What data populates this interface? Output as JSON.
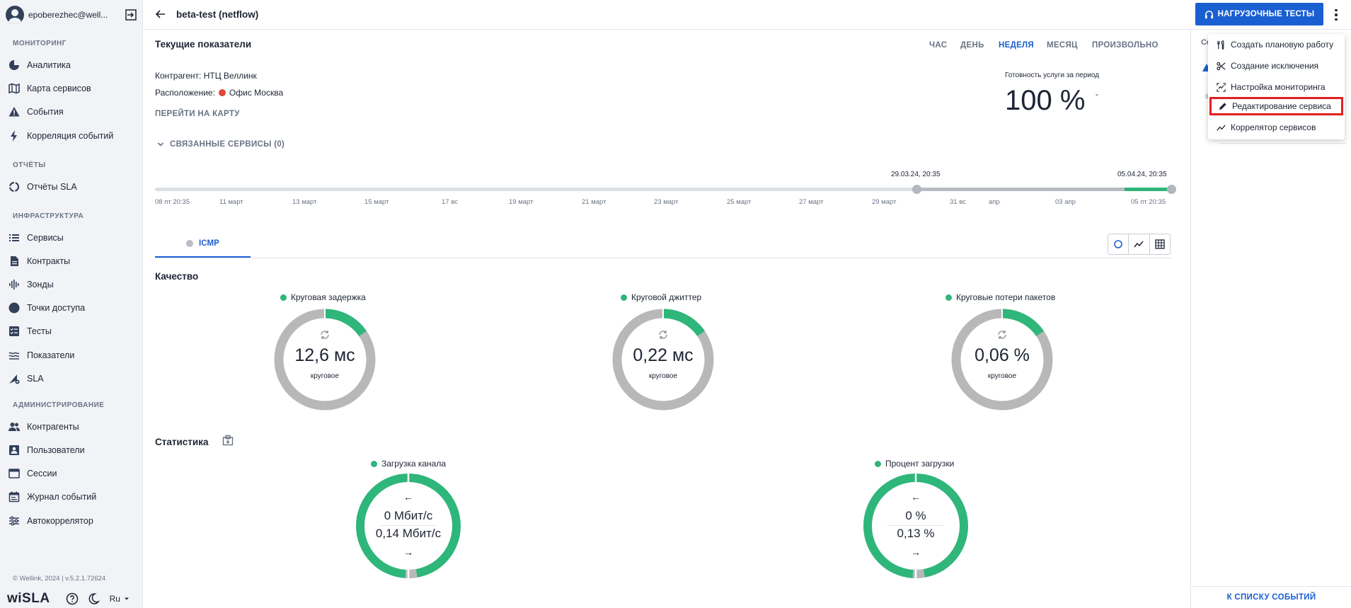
{
  "sidebar": {
    "user_email": "epoberezhec@well...",
    "sections": {
      "monitoring": "МОНИТОРИНГ",
      "reports": "ОТЧЁТЫ",
      "infrastructure": "ИНФРАСТРУКТУРА",
      "administration": "АДМИНИСТРИРОВАНИЕ"
    },
    "items": {
      "analytics": "Аналитика",
      "service_map": "Карта сервисов",
      "events": "События",
      "event_correlation": "Корреляция событий",
      "sla_reports": "Отчёты SLA",
      "services": "Сервисы",
      "contracts": "Контракты",
      "probes": "Зонды",
      "access_points": "Точки доступа",
      "tests": "Тесты",
      "indicators": "Показатели",
      "sla": "SLA",
      "counterparties": "Контрагенты",
      "users": "Пользователи",
      "sessions": "Сессии",
      "event_log": "Журнал событий",
      "autocorrelator": "Автокоррелятор"
    },
    "footer_copyright": "© Wellink, 2024 | v.5.2.1.72624",
    "logo": "wiSLA",
    "language": "Ru"
  },
  "topbar": {
    "title": "beta-test (netflow)",
    "load_tests_button": "НАГРУЗОЧНЫЕ ТЕСТЫ"
  },
  "current": {
    "title": "Текущие показатели",
    "periods": [
      "ЧАС",
      "ДЕНЬ",
      "НЕДЕЛЯ",
      "МЕСЯЦ",
      "ПРОИЗВОЛЬНО"
    ],
    "active_period": "НЕДЕЛЯ",
    "counterparty": "Контрагент: НТЦ Веллинк",
    "location_label": "Расположение:",
    "location_value": "Офис Москва",
    "map_link": "ПЕРЕЙТИ НА КАРТУ",
    "related_services": "СВЯЗАННЫЕ СЕРВИСЫ (0)",
    "readiness_label": "Готовность услуги за период",
    "readiness_value": "100 %",
    "readiness_dash": "-"
  },
  "timeline": {
    "range_start": "29.03.24, 20:35",
    "range_end": "05.04.24, 20:35",
    "ticks": [
      "08 пт 20:35",
      "11 март",
      "13 март",
      "15 март",
      "17 вс",
      "19 март",
      "21 март",
      "23 март",
      "25 март",
      "27 март",
      "29 март",
      "31 вс",
      "апр",
      "03 апр",
      "05 пт 20:35"
    ]
  },
  "tabs": {
    "icmp": "ICMP"
  },
  "quality": {
    "title": "Качество",
    "gauges": [
      {
        "label": "Круговая задержка",
        "value": "12,6 мс",
        "sub": "круговое"
      },
      {
        "label": "Круговой джиттер",
        "value": "0,22 мс",
        "sub": "круговое"
      },
      {
        "label": "Круговые потери пакетов",
        "value": "0,06 %",
        "sub": "круговое"
      }
    ]
  },
  "stats": {
    "title": "Статистика",
    "gauges": [
      {
        "label": "Загрузка канала",
        "in": "0 Мбит/с",
        "out": "0,14 Мбит/с"
      },
      {
        "label": "Процент загрузки",
        "in": "0 %",
        "out": "0,13 %"
      }
    ]
  },
  "right_panel": {
    "partial_title": "Сс",
    "footer_link": "К СПИСКУ СОБЫТИЙ"
  },
  "menu": {
    "items": [
      {
        "label": "Создать плановую работу",
        "icon": "wrench-icon"
      },
      {
        "label": "Создание исключения",
        "icon": "scissors-icon"
      },
      {
        "label": "Настройка мониторинга",
        "icon": "monitoring-settings-icon"
      },
      {
        "label": "Редактирование сервиса",
        "icon": "pencil-icon"
      },
      {
        "label": "Коррелятор сервисов",
        "icon": "trend-icon"
      }
    ]
  },
  "colors": {
    "accent": "#1a5fd1",
    "ok_green": "#2fb67a",
    "gauge_gray": "#b8b8b8",
    "alert_red": "#e0463a",
    "highlight_red": "#e02020"
  }
}
